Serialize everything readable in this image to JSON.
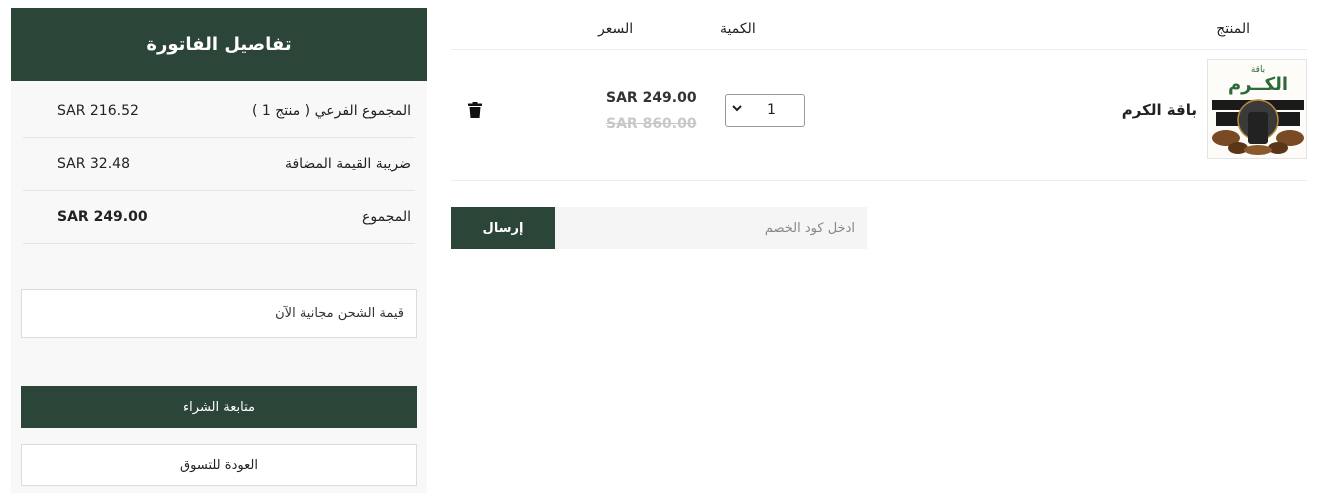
{
  "summary": {
    "title": "تفاصيل الفاتورة",
    "subtotal_label": "المجموع الفرعي ( منتج 1 )",
    "subtotal_value": "SAR 216.52",
    "vat_label": "ضريبة القيمة المضافة",
    "vat_value": "SAR 32.48",
    "total_label": "المجموع",
    "total_value": "SAR 249.00",
    "shipping_note": "قيمة الشحن مجانية الآن",
    "checkout_label": "متابعة الشراء",
    "continue_label": "العودة للتسوق"
  },
  "cart": {
    "headers": {
      "product": "المنتج",
      "quantity": "الكمية",
      "price": "السعر"
    },
    "items": [
      {
        "name": "باقة الكرم",
        "image_title_small": "باقة",
        "image_title_big": "الكــرم",
        "quantity": "1",
        "price": "SAR 249.00",
        "old_price": "SAR 860.00",
        "delete_icon": "trash-icon"
      }
    ]
  },
  "coupon": {
    "placeholder": "ادخل كود الخصم",
    "button_label": "إرسال"
  },
  "colors": {
    "brand_dark_green": "#2b4538",
    "panel_bg": "#f8f8f8",
    "old_price": "#c8c8c8"
  }
}
